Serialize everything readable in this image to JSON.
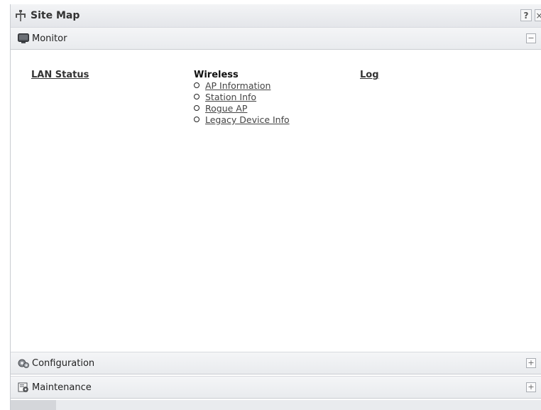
{
  "window": {
    "title": "Site Map",
    "faint_caption": "",
    "help_label": "?",
    "close_label": "×"
  },
  "sections": {
    "monitor": {
      "label": "Monitor",
      "toggle": "−"
    },
    "configuration": {
      "label": "Configuration",
      "toggle": "+"
    },
    "maintenance": {
      "label": "Maintenance",
      "toggle": "+"
    }
  },
  "monitor": {
    "lan_status": "LAN Status",
    "wireless": {
      "heading": "Wireless",
      "items": [
        "AP Information",
        "Station Info",
        "Rogue AP",
        "Legacy Device Info"
      ]
    },
    "log": "Log"
  },
  "icons": {
    "title": "sitemap-icon",
    "monitor": "monitor-icon",
    "configuration": "gears-icon",
    "maintenance": "maintenance-icon"
  }
}
